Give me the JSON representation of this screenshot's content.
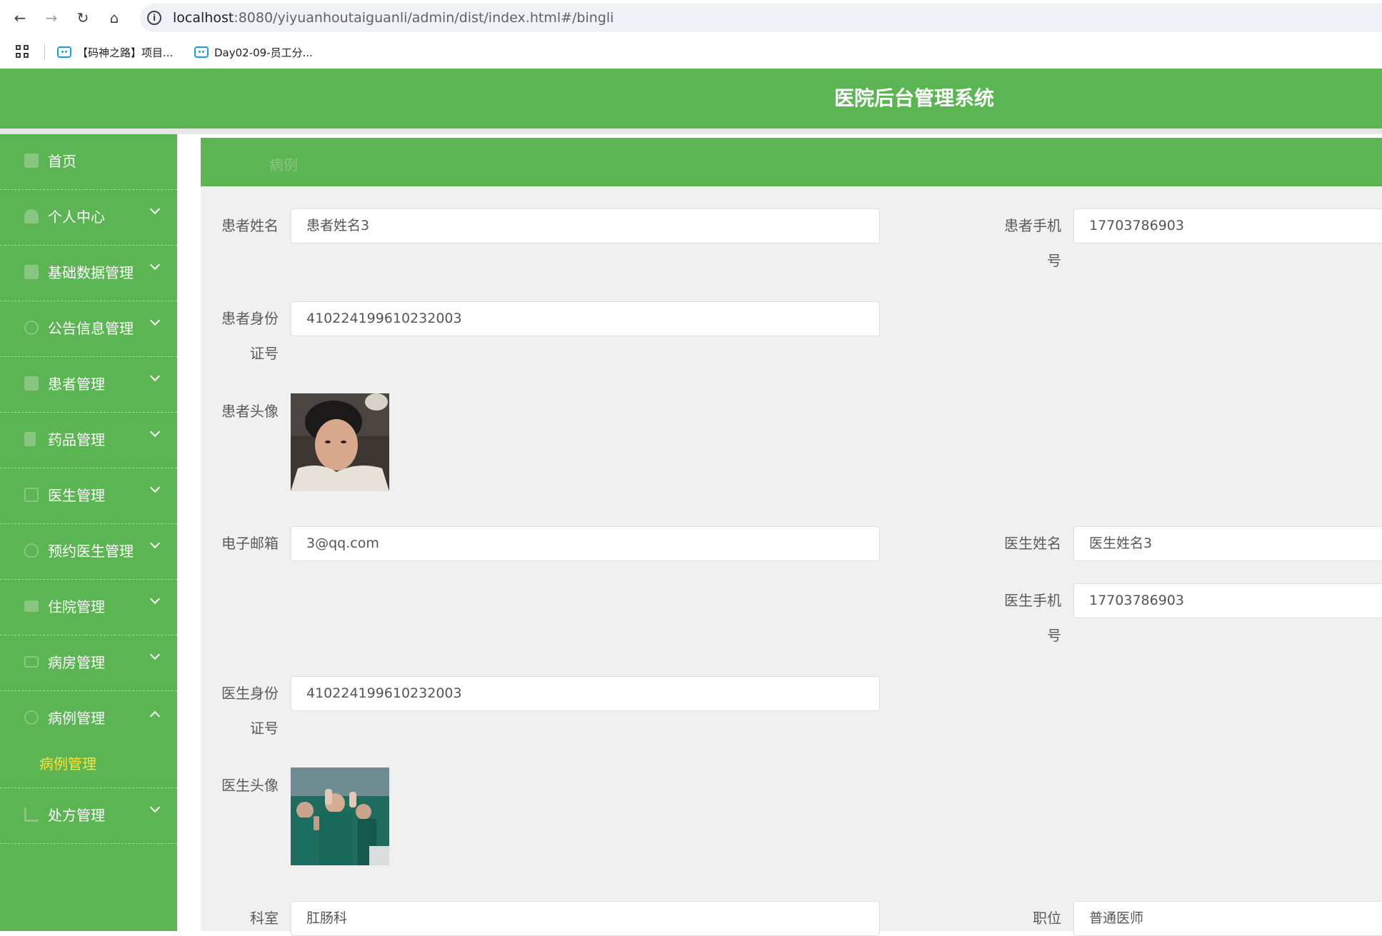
{
  "browser": {
    "url_host": "localhost",
    "url_path": ":8080/yiyuanhoutaiguanli/admin/dist/index.html#/bingli",
    "bookmarks": [
      "【码神之路】项目...",
      "Day02-09-员工分..."
    ]
  },
  "app": {
    "title": "医院后台管理系统"
  },
  "sidebar": {
    "items": [
      {
        "label": "首页",
        "icon": "home-icon"
      },
      {
        "label": "个人中心",
        "icon": "user-icon"
      },
      {
        "label": "基础数据管理",
        "icon": "briefcase-icon"
      },
      {
        "label": "公告信息管理",
        "icon": "clock-icon"
      },
      {
        "label": "患者管理",
        "icon": "grid-icon"
      },
      {
        "label": "药品管理",
        "icon": "flag-icon"
      },
      {
        "label": "医生管理",
        "icon": "clipboard-icon"
      },
      {
        "label": "预约医生管理",
        "icon": "bulb-icon"
      },
      {
        "label": "住院管理",
        "icon": "bed-icon"
      },
      {
        "label": "病房管理",
        "icon": "chart-icon"
      },
      {
        "label": "病例管理",
        "icon": "target-icon"
      },
      {
        "label": "处方管理",
        "icon": "bars-icon"
      }
    ],
    "sub_item": "病例管理"
  },
  "breadcrumb": {
    "current": "病例"
  },
  "form": {
    "patient_name_label": "患者姓名",
    "patient_name": "患者姓名3",
    "patient_phone_label_1": "患者手机",
    "patient_phone_label_2": "号",
    "patient_phone": "17703786903",
    "patient_id_label_1": "患者身份",
    "patient_id_label_2": "证号",
    "patient_id": "410224199610232003",
    "patient_avatar_label": "患者头像",
    "email_label": "电子邮箱",
    "email": "3@qq.com",
    "doctor_name_label": "医生姓名",
    "doctor_name": "医生姓名3",
    "doctor_phone_label_1": "医生手机",
    "doctor_phone_label_2": "号",
    "doctor_phone": "17703786903",
    "doctor_id_label_1": "医生身份",
    "doctor_id_label_2": "证号",
    "doctor_id": "410224199610232003",
    "doctor_avatar_label": "医生头像",
    "department_label": "科室",
    "department": "肛肠科",
    "position_label": "职位",
    "position": "普通医师"
  }
}
